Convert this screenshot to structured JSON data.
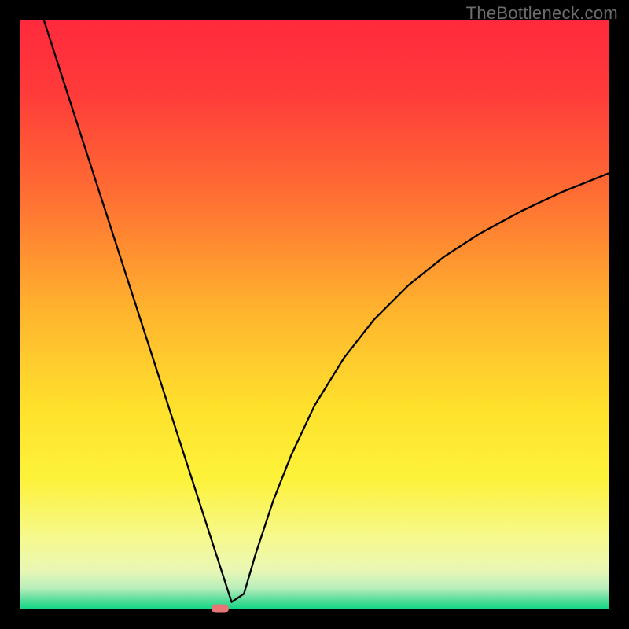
{
  "watermark": "TheBottleneck.com",
  "chart_data": {
    "type": "line",
    "title": "",
    "xlabel": "",
    "ylabel": "",
    "xlim": [
      0,
      100
    ],
    "ylim": [
      0,
      100
    ],
    "grid": false,
    "legend": false,
    "background_gradient_stops": [
      {
        "offset": 0.0,
        "color": "#ff2a3c"
      },
      {
        "offset": 0.12,
        "color": "#ff3a3a"
      },
      {
        "offset": 0.3,
        "color": "#ff6f33"
      },
      {
        "offset": 0.5,
        "color": "#ffb62e"
      },
      {
        "offset": 0.66,
        "color": "#ffe12c"
      },
      {
        "offset": 0.78,
        "color": "#fdf23a"
      },
      {
        "offset": 0.88,
        "color": "#f6f98e"
      },
      {
        "offset": 0.935,
        "color": "#e9f7b4"
      },
      {
        "offset": 0.965,
        "color": "#b9eebc"
      },
      {
        "offset": 0.985,
        "color": "#59dd9a"
      },
      {
        "offset": 1.0,
        "color": "#13d886"
      }
    ],
    "series": [
      {
        "name": "bottleneck-curve",
        "color": "#000000",
        "x": [
          4,
          6,
          8,
          10,
          12,
          14,
          16,
          18,
          20,
          22,
          24,
          26,
          28,
          30,
          32,
          33.5,
          34.7,
          35.9,
          38,
          40,
          43,
          46,
          50,
          55,
          60,
          66,
          72,
          78,
          85,
          92,
          100
        ],
        "values": [
          100,
          93.8,
          87.6,
          81.4,
          75.2,
          69.0,
          62.8,
          56.6,
          50.4,
          44.2,
          38.0,
          31.8,
          25.6,
          19.4,
          13.2,
          8.55,
          4.83,
          1.11,
          2.51,
          9.32,
          18.4,
          26.0,
          34.5,
          42.6,
          49.0,
          55.0,
          59.8,
          63.7,
          67.5,
          70.8,
          74.0
        ]
      }
    ],
    "marker": {
      "x": 34.0,
      "y": 0.0,
      "color": "#e77576"
    },
    "annotations": []
  }
}
